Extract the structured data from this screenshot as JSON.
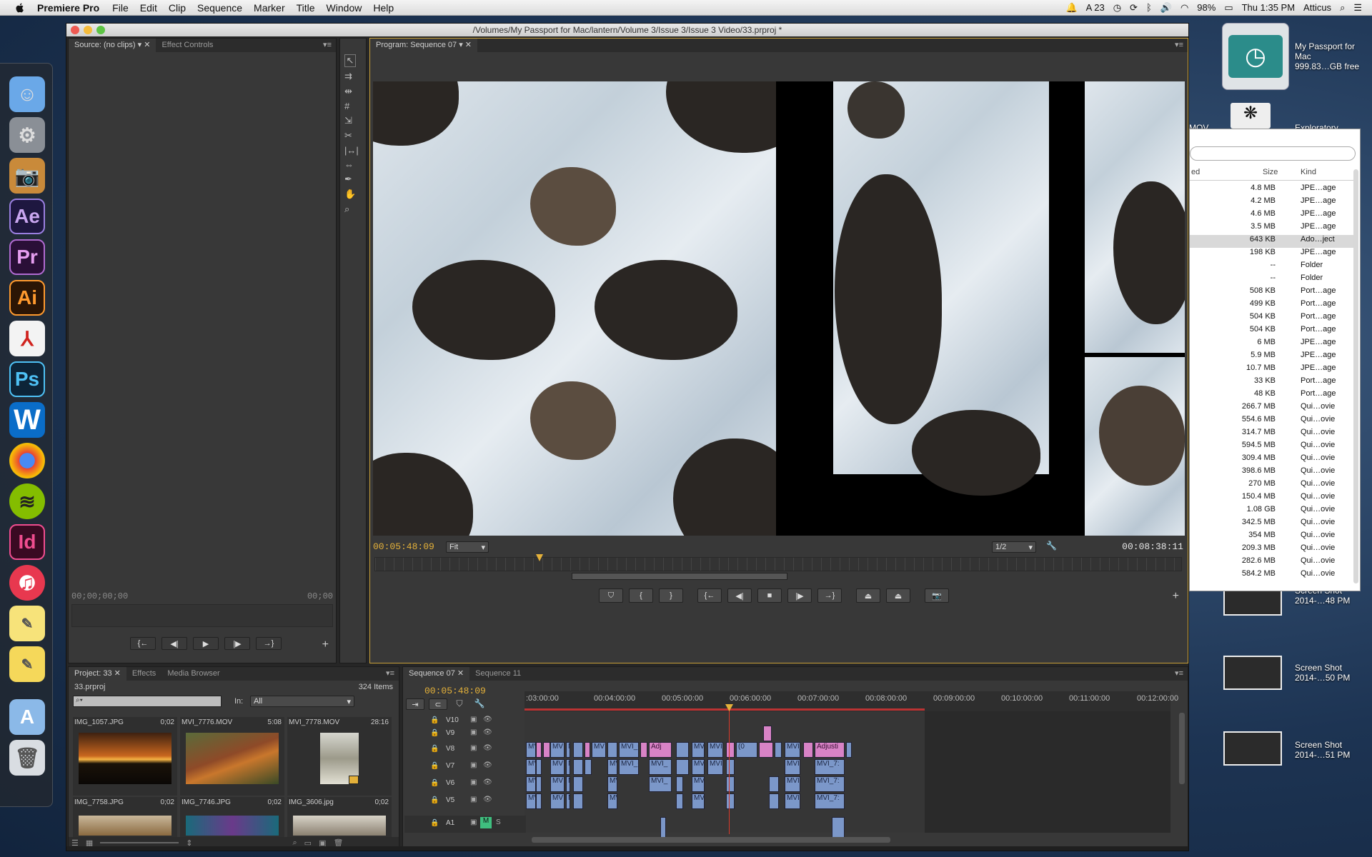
{
  "menubar": {
    "app_name": "Premiere Pro",
    "items": [
      "File",
      "Edit",
      "Clip",
      "Sequence",
      "Marker",
      "Title",
      "Window",
      "Help"
    ],
    "adobe_count": "23",
    "battery": "98%",
    "clock": "Thu 1:35 PM",
    "user": "Atticus"
  },
  "window": {
    "title": "/Volumes/My Passport for Mac/lantern/Volume 3/Issue 3/Issue 3 Video/33.prproj *"
  },
  "source_panel": {
    "tabs": [
      "Source: (no clips)",
      "Effect Controls"
    ],
    "timecode_left": "00;00;00;00",
    "timecode_right": "00;00"
  },
  "program_panel": {
    "tab": "Program: Sequence 07",
    "timecode": "00:05:48:09",
    "zoom": "Fit",
    "resolution": "1/2",
    "duration": "00:08:38:11"
  },
  "project_panel": {
    "tabs": [
      "Project: 33",
      "Effects",
      "Media Browser"
    ],
    "project_file": "33.prproj",
    "item_count": "324 Items",
    "in_label": "In:",
    "in_value": "All",
    "items": [
      {
        "name": "IMG_1057.JPG",
        "dur": "0;02"
      },
      {
        "name": "MVI_7776.MOV",
        "dur": "5:08"
      },
      {
        "name": "MVI_7778.MOV",
        "dur": "28:16"
      },
      {
        "name": "IMG_7758.JPG",
        "dur": "0;02"
      },
      {
        "name": "IMG_7746.JPG",
        "dur": "0;02"
      },
      {
        "name": "IMG_3606.jpg",
        "dur": "0;02"
      }
    ]
  },
  "timeline": {
    "tabs": [
      "Sequence 07",
      "Sequence 11"
    ],
    "timecode": "00:05:48:09",
    "ruler": [
      ":03:00:00",
      "00:04:00:00",
      "00:05:00:00",
      "00:06:00:00",
      "00:07:00:00",
      "00:08:00:00",
      "00:09:00:00",
      "00:10:00:00",
      "00:11:00:00",
      "00:12:00:00"
    ],
    "tracks": [
      "V10",
      "V9",
      "V8",
      "V7",
      "V6",
      "V5",
      "A1"
    ],
    "clip_labels": [
      "MV",
      "MVI_C",
      "Adj",
      "MVI",
      "Adjusti",
      "MVI_",
      "MVI_7:",
      "(0"
    ],
    "audio_m": "M",
    "audio_s": "S"
  },
  "desktop": {
    "drive_name": "My Passport for Mac",
    "drive_free": "999.83…GB free",
    "exploratory_label": "Exploratory",
    "mov_label": "MOV",
    "screenshots": [
      {
        "line1": "Screen Shot",
        "line2": "2014-…48 PM"
      },
      {
        "line1": "Screen Shot",
        "line2": "2014-…50 PM"
      },
      {
        "line1": "Screen Shot",
        "line2": "2014-…51 PM"
      }
    ]
  },
  "finder": {
    "headers": {
      "date": "ed",
      "size": "Size",
      "kind": "Kind"
    },
    "rows": [
      {
        "size": "4.8 MB",
        "kind": "JPE…age"
      },
      {
        "size": "4.2 MB",
        "kind": "JPE…age"
      },
      {
        "size": "4.6 MB",
        "kind": "JPE…age"
      },
      {
        "size": "3.5 MB",
        "kind": "JPE…age"
      },
      {
        "size": "643 KB",
        "kind": "Ado…ject"
      },
      {
        "size": "198 KB",
        "kind": "JPE…age"
      },
      {
        "size": "--",
        "kind": "Folder"
      },
      {
        "size": "--",
        "kind": "Folder"
      },
      {
        "size": "508 KB",
        "kind": "Port…age"
      },
      {
        "size": "499 KB",
        "kind": "Port…age"
      },
      {
        "size": "504 KB",
        "kind": "Port…age"
      },
      {
        "size": "504 KB",
        "kind": "Port…age"
      },
      {
        "size": "6 MB",
        "kind": "JPE…age"
      },
      {
        "size": "5.9 MB",
        "kind": "JPE…age"
      },
      {
        "size": "10.7 MB",
        "kind": "JPE…age"
      },
      {
        "size": "33 KB",
        "kind": "Port…age"
      },
      {
        "size": "48 KB",
        "kind": "Port…age"
      },
      {
        "size": "266.7 MB",
        "kind": "Qui…ovie"
      },
      {
        "size": "554.6 MB",
        "kind": "Qui…ovie"
      },
      {
        "size": "314.7 MB",
        "kind": "Qui…ovie"
      },
      {
        "size": "594.5 MB",
        "kind": "Qui…ovie"
      },
      {
        "size": "309.4 MB",
        "kind": "Qui…ovie"
      },
      {
        "size": "398.6 MB",
        "kind": "Qui…ovie"
      },
      {
        "size": "270 MB",
        "kind": "Qui…ovie"
      },
      {
        "size": "150.4 MB",
        "kind": "Qui…ovie"
      },
      {
        "size": "1.08 GB",
        "kind": "Qui…ovie"
      },
      {
        "size": "342.5 MB",
        "kind": "Qui…ovie"
      },
      {
        "size": "354 MB",
        "kind": "Qui…ovie"
      },
      {
        "size": "209.3 MB",
        "kind": "Qui…ovie"
      },
      {
        "size": "282.6 MB",
        "kind": "Qui…ovie"
      },
      {
        "size": "584.2 MB",
        "kind": "Qui…ovie"
      }
    ]
  },
  "colors": {
    "timecode_yellow": "#e4b13a",
    "clip_blue": "#7b97c9",
    "clip_pink": "#d883c6",
    "playhead_red": "#d83a2a"
  }
}
